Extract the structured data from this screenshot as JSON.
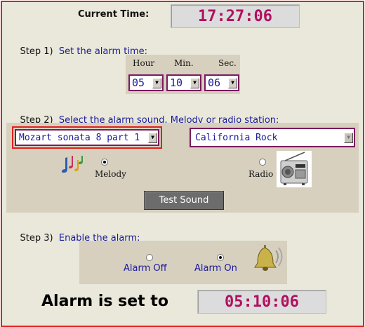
{
  "current_time": {
    "label": "Current Time:",
    "value": "17:27:06"
  },
  "step1": {
    "title": "Step 1)  Set the alarm time:",
    "hour_label": "Hour",
    "min_label": "Min.",
    "sec_label": "Sec.",
    "hour_value": "05",
    "min_value": "10",
    "sec_value": "06"
  },
  "step2": {
    "title": "Step 2)  Select the alarm sound. Melody or radio station:",
    "melody_select": "Mozart sonata 8 part 1",
    "radio_select": "California Rock",
    "melody_label": "Melody",
    "radio_label": "Radio",
    "selected_source": "melody",
    "test_button": "Test Sound"
  },
  "step3": {
    "title": "Step 3)  Enable the alarm:",
    "alarm_off_label": "Alarm Off",
    "alarm_on_label": "Alarm On",
    "alarm_state": "on"
  },
  "alarm_set": {
    "label": "Alarm is set to",
    "value": "05:10:06"
  },
  "colors": {
    "frame_border": "#e0201e",
    "background": "#e9e8da",
    "panel": "#d7d0bf",
    "time_text": "#b0105f",
    "step_text": "#1a1a9a"
  },
  "icons": [
    "music-notes-icon",
    "radio-icon",
    "bell-icon"
  ]
}
